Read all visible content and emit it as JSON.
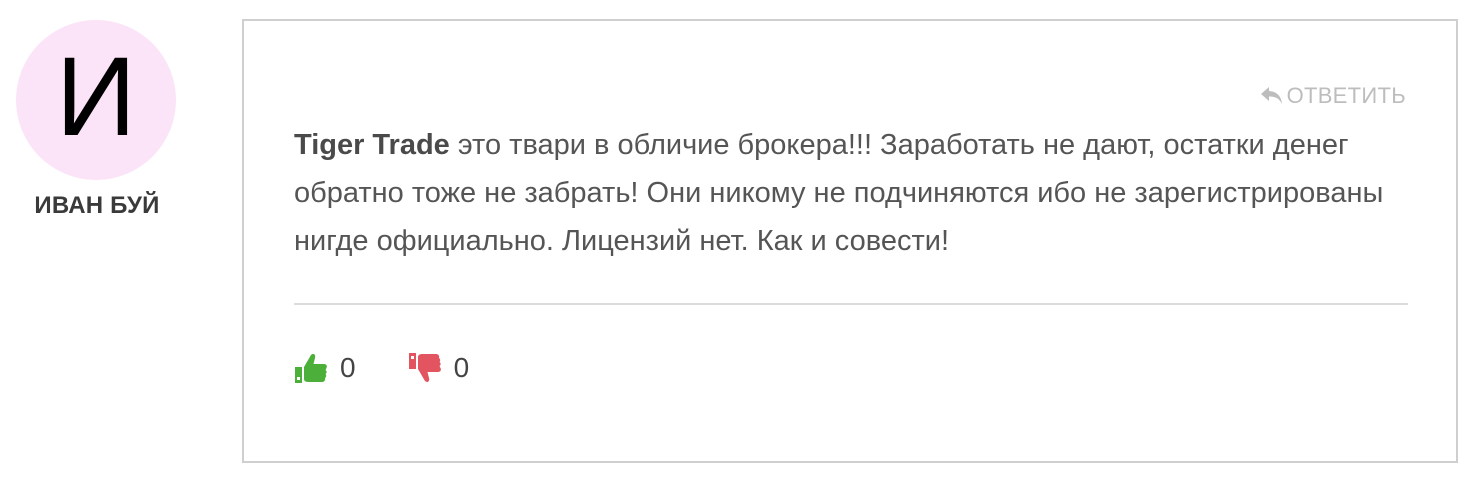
{
  "author": {
    "avatar_letter": "И",
    "avatar_color": "#fbe4f7",
    "name": "ИВАН БУЙ"
  },
  "comment": {
    "reply_label": "ОТВЕТИТЬ",
    "reply_icon": "reply-arrow-icon",
    "mention": "Tiger Trade",
    "text": " это твари в обличие брокера!!! Заработать не дают, остатки денег обратно тоже не забрать! Они никому не подчиняются ибо не зарегистрированы нигде официально. Лицензий нет. Как и совести!",
    "likes": {
      "icon": "thumbs-up-icon",
      "count": "0",
      "color": "#4caf3a"
    },
    "dislikes": {
      "icon": "thumbs-down-icon",
      "count": "0",
      "color": "#e2545f"
    }
  }
}
